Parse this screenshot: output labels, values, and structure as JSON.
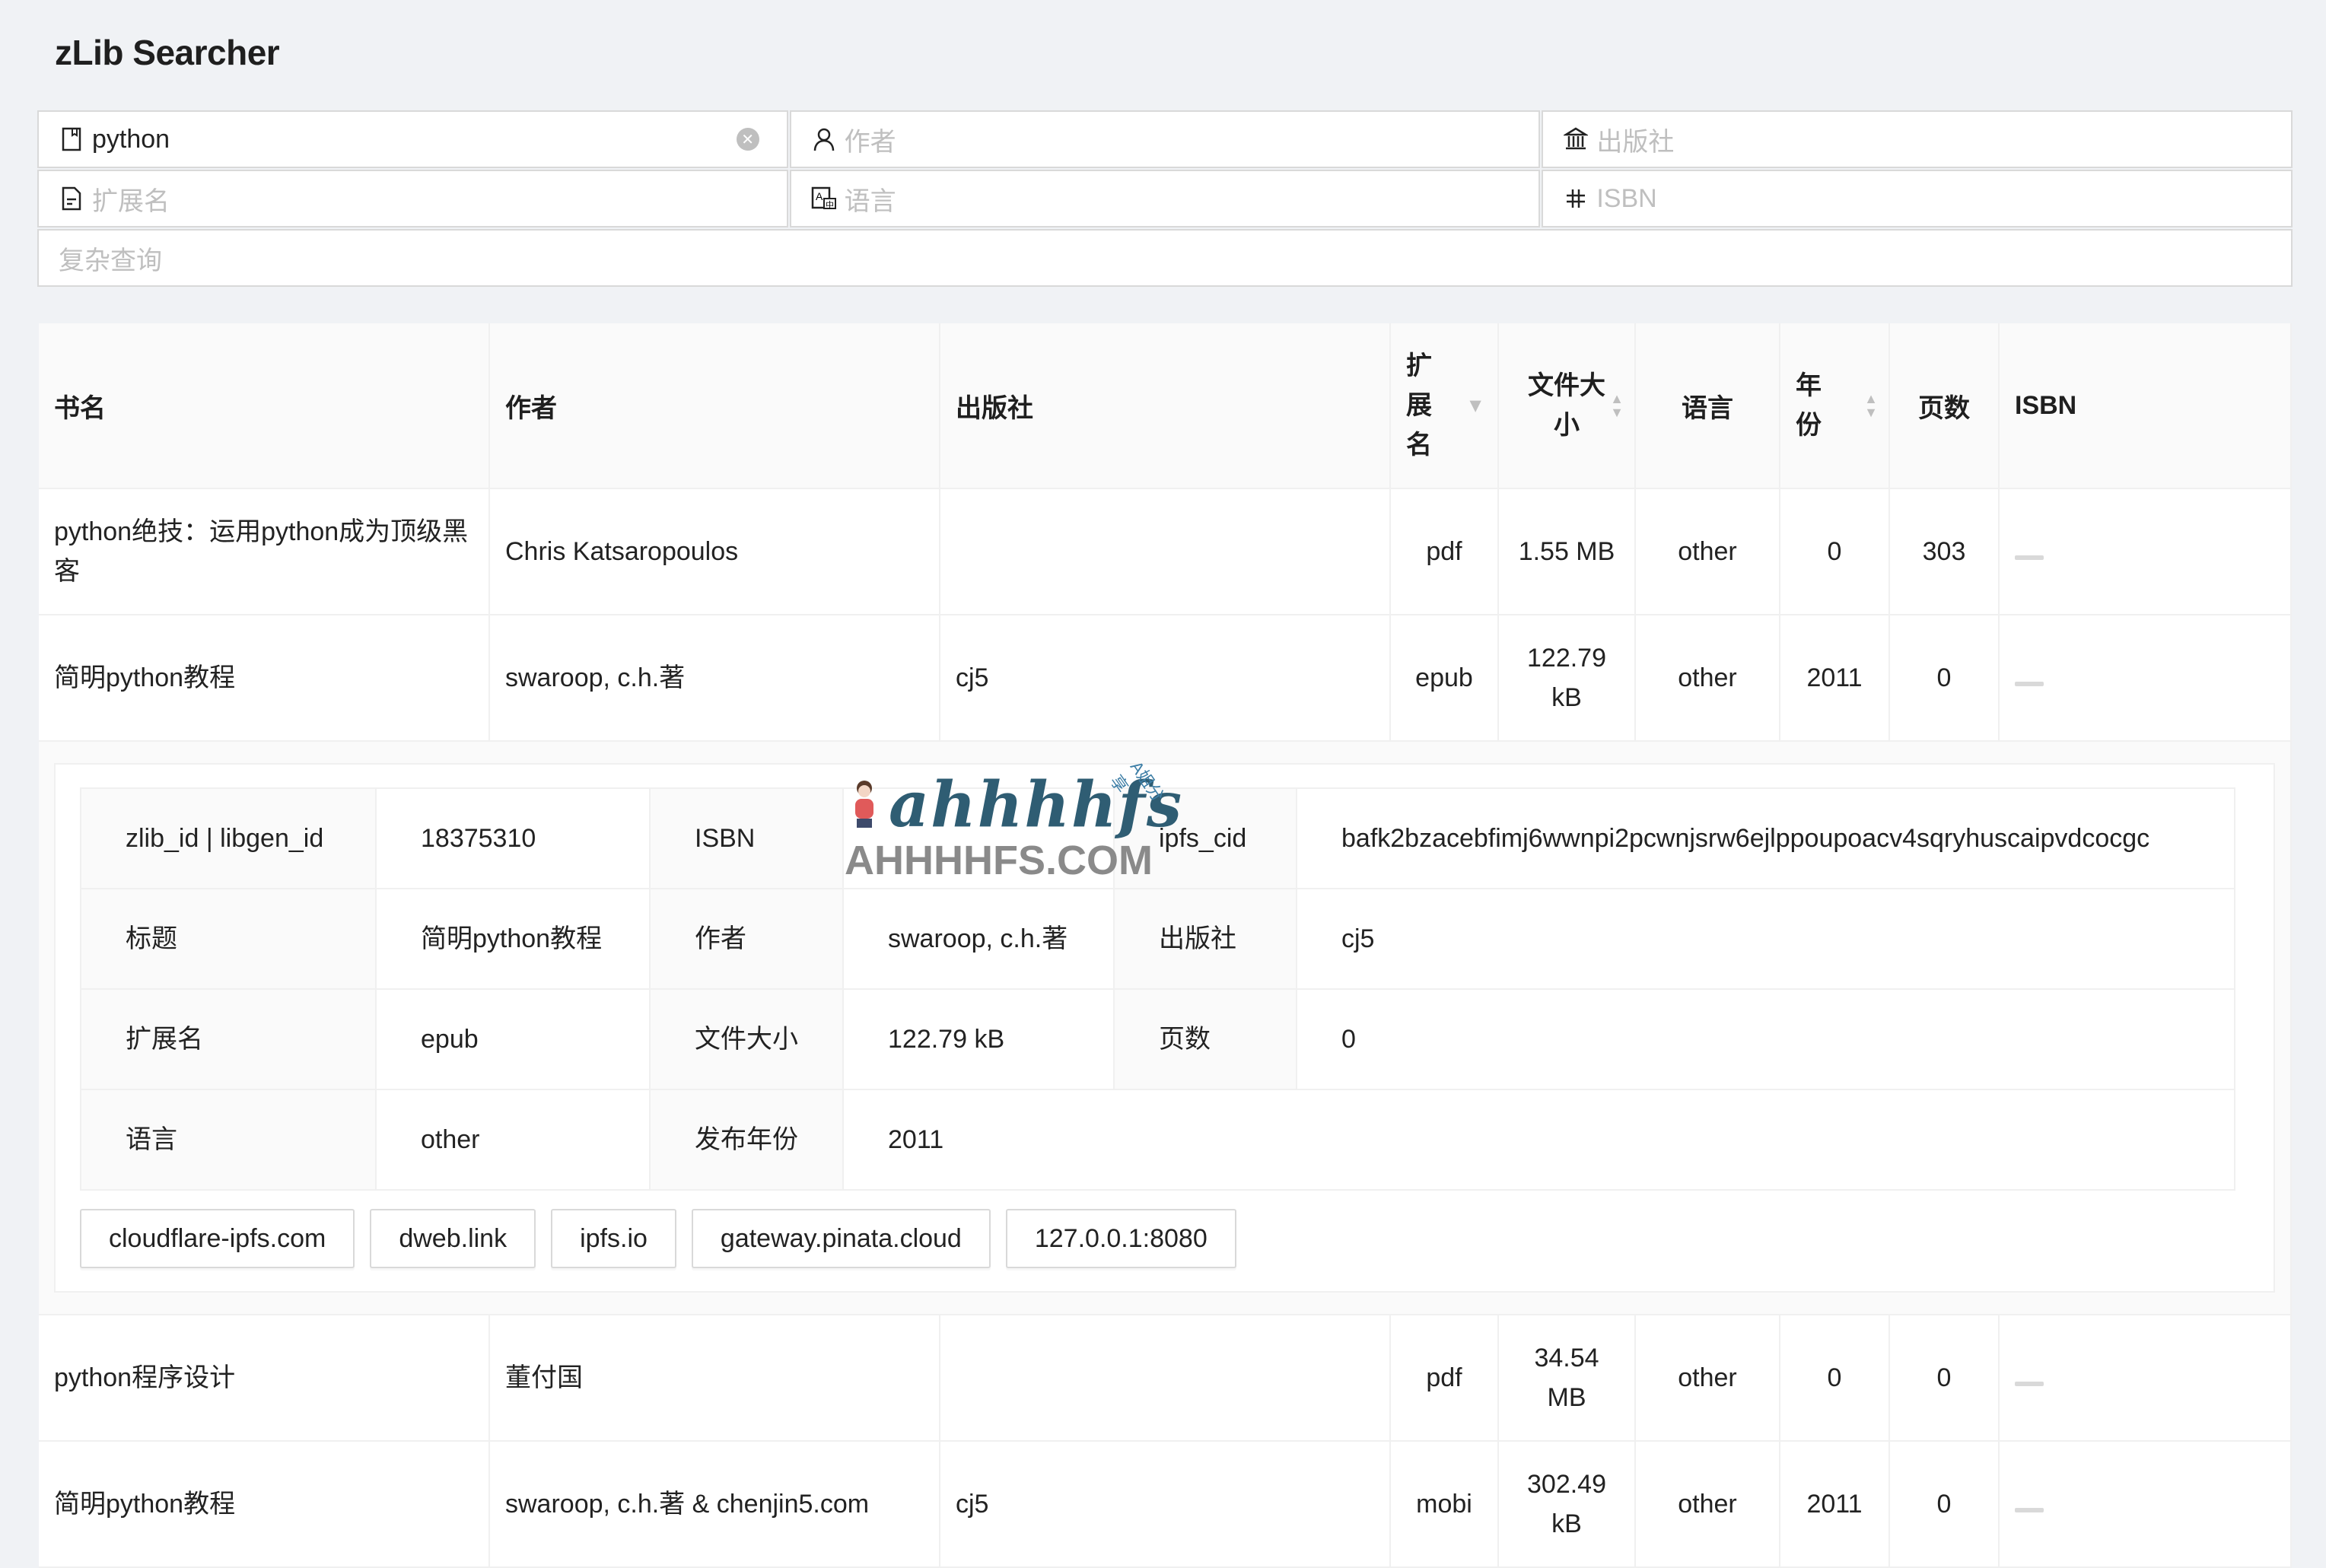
{
  "app": {
    "title": "zLib Searcher"
  },
  "search": {
    "title_value": "python",
    "author_placeholder": "作者",
    "publisher_placeholder": "出版社",
    "extension_placeholder": "扩展名",
    "language_placeholder": "语言",
    "isbn_placeholder": "ISBN",
    "complex_placeholder": "复杂查询",
    "icons": {
      "title": "book-icon",
      "author": "user-icon",
      "publisher": "bank-icon",
      "extension": "file-text-icon",
      "language": "translation-icon",
      "isbn": "number-icon",
      "clear": "close-circle-icon"
    }
  },
  "table": {
    "columns": [
      "书名",
      "作者",
      "出版社",
      "扩展名",
      "文件大小",
      "语言",
      "年份",
      "页数",
      "ISBN"
    ],
    "rows": [
      {
        "title": "python绝技：运用python成为顶级黑客",
        "author": "Chris Katsaropoulos",
        "publisher": "",
        "ext": "pdf",
        "size": "1.55 MB",
        "lang": "other",
        "year": "0",
        "pages": "303",
        "isbn": ""
      },
      {
        "title": "简明python教程",
        "author": "swaroop, c.h.著",
        "publisher": "cj5",
        "ext": "epub",
        "size": "122.79 kB",
        "lang": "other",
        "year": "2011",
        "pages": "0",
        "isbn": ""
      },
      {
        "title": "python程序设计",
        "author": "董付国",
        "publisher": "",
        "ext": "pdf",
        "size": "34.54 MB",
        "lang": "other",
        "year": "0",
        "pages": "0",
        "isbn": ""
      },
      {
        "title": "简明python教程",
        "author": "swaroop, c.h.著 & chenjin5.com",
        "publisher": "cj5",
        "ext": "mobi",
        "size": "302.49 kB",
        "lang": "other",
        "year": "2011",
        "pages": "0",
        "isbn": ""
      }
    ]
  },
  "detail": {
    "labels": {
      "id": "zlib_id | libgen_id",
      "isbn": "ISBN",
      "ipfs": "ipfs_cid",
      "title": "标题",
      "author": "作者",
      "publisher": "出版社",
      "ext": "扩展名",
      "size": "文件大小",
      "pages": "页数",
      "lang": "语言",
      "year": "发布年份"
    },
    "values": {
      "id": "18375310",
      "isbn": "",
      "ipfs": "bafk2bzacebfimj6wwnpi2pcwnjsrw6ejlppoupoacv4sqryhuscaipvdcocgc",
      "title": "简明python教程",
      "author": "swaroop, c.h.著",
      "publisher": "cj5",
      "ext": "epub",
      "size": "122.79 kB",
      "pages": "0",
      "lang": "other",
      "year": "2011"
    },
    "gateways": [
      "cloudflare-ipfs.com",
      "dweb.link",
      "ipfs.io",
      "gateway.pinata.cloud",
      "127.0.0.1:8080"
    ]
  },
  "watermark": {
    "top": "ahhhhfs",
    "bottom": "AHHHHFS.COM",
    "side": "A姐分享"
  }
}
